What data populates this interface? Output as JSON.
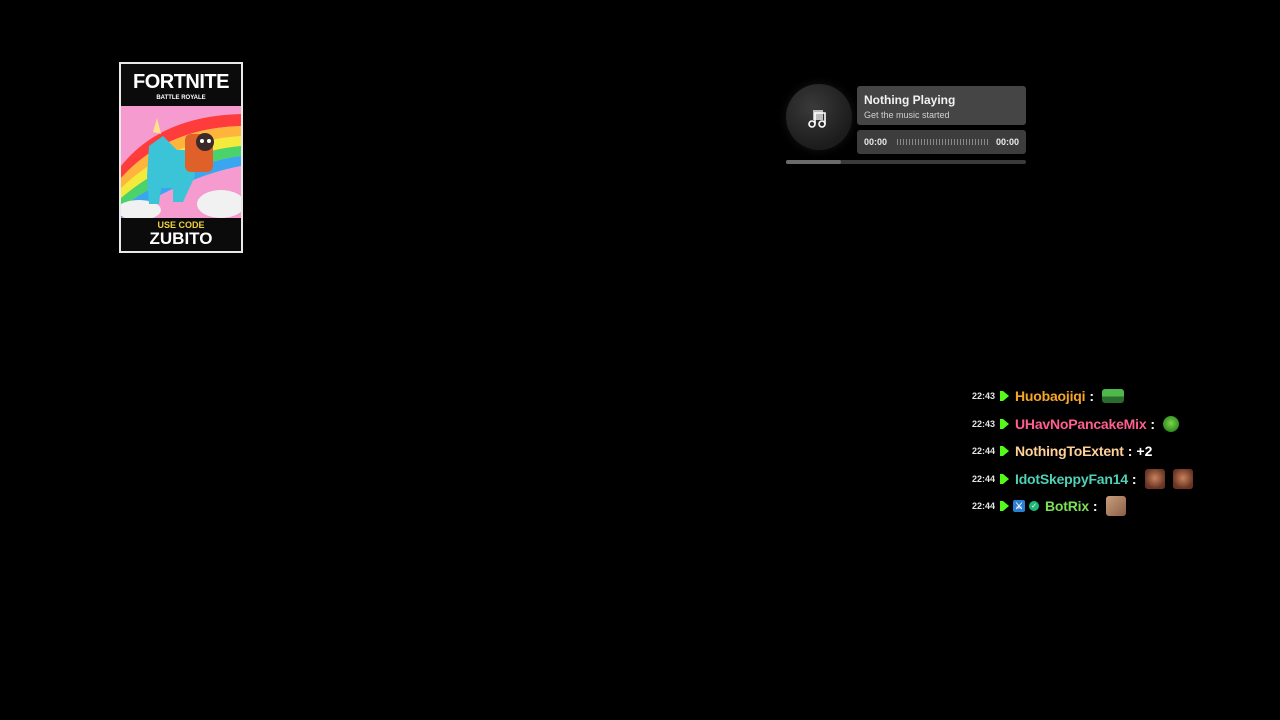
{
  "promo": {
    "title": "FORTNITE",
    "subtitle": "BATTLE ROYALE",
    "code_label": "USE CODE",
    "code": "ZUBITO"
  },
  "music": {
    "title": "Nothing Playing",
    "subtitle": "Get the music started",
    "time_elapsed": "00:00",
    "time_total": "00:00",
    "progress": 0.23,
    "icon": "music-note-icon"
  },
  "chat": {
    "messages": [
      {
        "time": "22:43",
        "username": "Huobaojiqi",
        "color": "#f6a623",
        "text": "",
        "emotes": [
          "frog-emote"
        ]
      },
      {
        "time": "22:43",
        "username": "UHavNoPancakeMix",
        "color": "#ff5f8f",
        "text": "",
        "emotes": [
          "green-blob-emote"
        ]
      },
      {
        "time": "22:44",
        "username": "NothingToExtent",
        "color": "#ffd199",
        "text": "+2",
        "emotes": []
      },
      {
        "time": "22:44",
        "username": "IdotSkeppyFan14",
        "color": "#4fd1b5",
        "text": "",
        "emotes": [
          "face-emote",
          "face-emote"
        ]
      },
      {
        "time": "22:44",
        "username": "BotRix",
        "color": "#7be054",
        "text": "",
        "emotes": [
          "dog-emote"
        ]
      }
    ]
  },
  "colors": {
    "kick_green": "#53fc18",
    "background": "#000000"
  }
}
